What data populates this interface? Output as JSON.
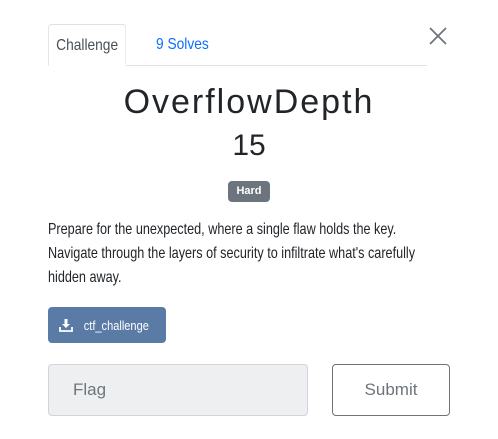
{
  "tabs": {
    "challenge_label": "Challenge",
    "solves_label": "9 Solves"
  },
  "challenge": {
    "name": "OverflowDepth",
    "value": "15",
    "difficulty": "Hard",
    "description_lines": [
      "Prepare for the unexpected, where a single flaw holds the key.",
      "Navigate through the layers of security to infiltrate what's carefully",
      "hidden away."
    ]
  },
  "file": {
    "label": "ctf_challenge",
    "icon": "download-icon"
  },
  "form": {
    "flag_placeholder": "Flag",
    "flag_value": "",
    "submit_label": "Submit"
  },
  "colors": {
    "link": "#0d6efd",
    "badge": "#6c757d",
    "file_button": "#5a7ba6"
  }
}
